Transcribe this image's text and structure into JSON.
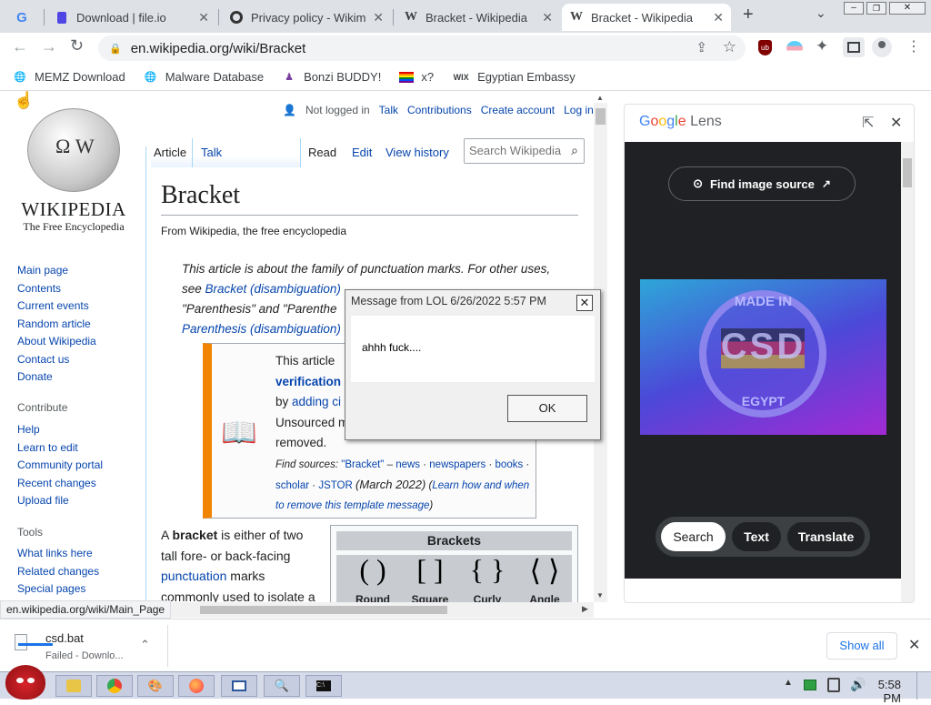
{
  "tabs": [
    {
      "title": "",
      "favicon": "google-icon"
    },
    {
      "title": "Download | file.io",
      "favicon": "fileio-icon"
    },
    {
      "title": "Privacy policy - Wikim",
      "favicon": "wikimedia-icon"
    },
    {
      "title": "Bracket - Wikipedia",
      "favicon": "wikipedia-icon"
    },
    {
      "title": "Bracket - Wikipedia",
      "favicon": "wikipedia-icon",
      "active": true
    }
  ],
  "address": {
    "url": "en.wikipedia.org/wiki/Bracket"
  },
  "bookmarks": [
    "MEMZ Download",
    "Malware Database",
    "Bonzi BUDDY!",
    "x?",
    "Egyptian Embassy"
  ],
  "wiki": {
    "logo_title": "WIKIPEDIA",
    "logo_subtitle": "The Free Encyclopedia",
    "user_links": {
      "not_logged": "Not logged in",
      "talk": "Talk",
      "contributions": "Contributions",
      "create": "Create account",
      "login": "Log in"
    },
    "tabs": {
      "article": "Article",
      "talk": "Talk",
      "read": "Read",
      "edit": "Edit",
      "history": "View history"
    },
    "search_placeholder": "Search Wikipedia",
    "title": "Bracket",
    "from": "From Wikipedia, the free encyclopedia",
    "hatnote": {
      "p1": "This article is about the family of punctuation marks. For other uses,",
      "p2a": "see ",
      "link1": "Bracket (disambiguation)",
      "p3": "\"Parenthesis\" and \"Parenthe",
      "link2": "Parenthesis (disambiguation)"
    },
    "notice": {
      "line1": "This article ",
      "line2": "verification",
      "line3a": "by ",
      "line3b": "adding ci",
      "line4": "Unsourced m",
      "line5": "removed.",
      "find_label": "Find sources:",
      "find_q": "\"Bracket\"",
      "find_links": [
        "news",
        "newspapers",
        "books",
        "scholar",
        "JSTOR"
      ],
      "date": "(March 2022)",
      "learn": "Learn how and when to remove this template message"
    },
    "body": {
      "p1a": "A ",
      "p1b": "bracket",
      "p1c": " is either of two",
      "p2": "tall fore- or back-facing",
      "p3": "punctuation",
      "p3b": " marks",
      "p4": "commonly used to isolate a"
    },
    "infobox": {
      "title": "Brackets",
      "labels": [
        "Round",
        "Square",
        "Curly",
        "Angle"
      ],
      "glyphs": [
        "( )",
        "[ ]",
        "{ }",
        "⟨ ⟩"
      ]
    },
    "sidebar": {
      "nav": [
        "Main page",
        "Contents",
        "Current events",
        "Random article",
        "About Wikipedia",
        "Contact us",
        "Donate"
      ],
      "contribute_head": "Contribute",
      "contribute": [
        "Help",
        "Learn to edit",
        "Community portal",
        "Recent changes",
        "Upload file"
      ],
      "tools_head": "Tools",
      "tools": [
        "What links here",
        "Related changes",
        "Special pages"
      ]
    },
    "status_url": "en.wikipedia.org/wiki/Main_Page"
  },
  "dialog": {
    "title": "Message from LOL 6/26/2022 5:57 PM",
    "message": "ahhh fuck....",
    "ok": "OK"
  },
  "lens": {
    "brand": "Google Lens",
    "find_source": "Find image source",
    "image_text_top": "MADE IN",
    "image_text_mid": "CSD",
    "image_text_bot": "EGYPT",
    "buttons": [
      "Search",
      "Text",
      "Translate"
    ]
  },
  "download": {
    "file": "csd.bat",
    "status": "Failed - Downlo...",
    "show_all": "Show all"
  },
  "taskbar": {
    "clock": "5:58 PM"
  }
}
